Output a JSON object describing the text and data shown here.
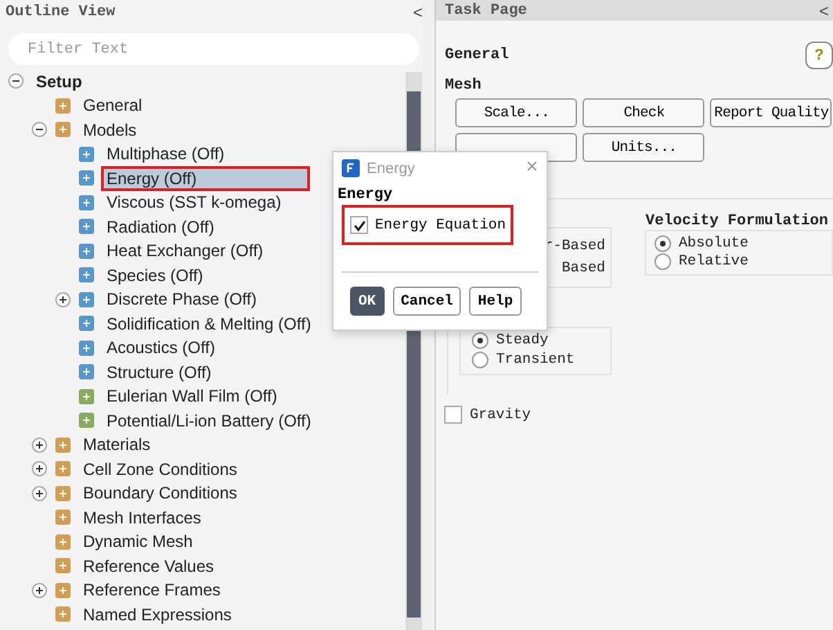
{
  "outline": {
    "title": "Outline View",
    "collapse": "<",
    "filter": {
      "placeholder": "Filter Text"
    },
    "tree": [
      {
        "label": "Setup",
        "expanded": true,
        "selected": false,
        "highlighted": false,
        "children": [
          {
            "label": "General",
            "selected": false,
            "highlighted": false
          },
          {
            "label": "Models",
            "expanded": true,
            "selected": false,
            "highlighted": false,
            "children": [
              {
                "label": "Multiphase (Off)",
                "selected": false,
                "highlighted": false
              },
              {
                "label": "Energy (Off)",
                "selected": true,
                "highlighted": true
              },
              {
                "label": "Viscous (SST k-omega)",
                "selected": false,
                "highlighted": false
              },
              {
                "label": "Radiation (Off)",
                "selected": false,
                "highlighted": false
              },
              {
                "label": "Heat Exchanger (Off)",
                "selected": false,
                "highlighted": false
              },
              {
                "label": "Species (Off)",
                "selected": false,
                "highlighted": false
              },
              {
                "label": "Discrete Phase (Off)",
                "expanded": false,
                "selected": false,
                "highlighted": false
              },
              {
                "label": "Solidification & Melting (Off)",
                "selected": false,
                "highlighted": false
              },
              {
                "label": "Acoustics (Off)",
                "selected": false,
                "highlighted": false
              },
              {
                "label": "Structure (Off)",
                "selected": false,
                "highlighted": false
              },
              {
                "label": "Eulerian Wall Film (Off)",
                "selected": false,
                "highlighted": false
              },
              {
                "label": "Potential/Li-ion Battery (Off)",
                "selected": false,
                "highlighted": false
              }
            ]
          },
          {
            "label": "Materials",
            "expanded": false,
            "selected": false,
            "highlighted": false
          },
          {
            "label": "Cell Zone Conditions",
            "expanded": false,
            "selected": false,
            "highlighted": false
          },
          {
            "label": "Boundary Conditions",
            "expanded": false,
            "selected": false,
            "highlighted": false
          },
          {
            "label": "Mesh Interfaces",
            "selected": false,
            "highlighted": false
          },
          {
            "label": "Dynamic Mesh",
            "selected": false,
            "highlighted": false
          },
          {
            "label": "Reference Values",
            "selected": false,
            "highlighted": false
          },
          {
            "label": "Reference Frames",
            "expanded": false,
            "selected": false,
            "highlighted": false
          },
          {
            "label": "Named Expressions",
            "selected": false,
            "highlighted": false
          }
        ]
      }
    ]
  },
  "task_page": {
    "title": "Task Page",
    "collapse": "<",
    "heading": "General",
    "help": "?",
    "mesh": {
      "label": "Mesh",
      "buttons": [
        [
          "Scale...",
          "Check",
          "Report Quality"
        ],
        [
          "Units..."
        ]
      ]
    },
    "solver_type": {
      "options": [
        "r-Based",
        "Based"
      ]
    },
    "velocity": {
      "label": "Velocity Formulation",
      "options": [
        {
          "label": "Absolute",
          "selected": true
        },
        {
          "label": "Relative",
          "selected": false
        }
      ]
    },
    "time": {
      "options": [
        {
          "label": "Steady",
          "selected": true
        },
        {
          "label": "Transient",
          "selected": false
        }
      ]
    },
    "gravity": {
      "label": "Gravity",
      "checked": false
    }
  },
  "dialog": {
    "title": "Energy",
    "close": "×",
    "group": "Energy",
    "option": {
      "label": "Energy Equation",
      "checked": true,
      "highlighted": true
    },
    "buttons": [
      {
        "label": "OK",
        "kind": "default"
      },
      {
        "label": "Cancel",
        "kind": "normal"
      },
      {
        "label": "Help",
        "kind": "normal"
      }
    ]
  }
}
